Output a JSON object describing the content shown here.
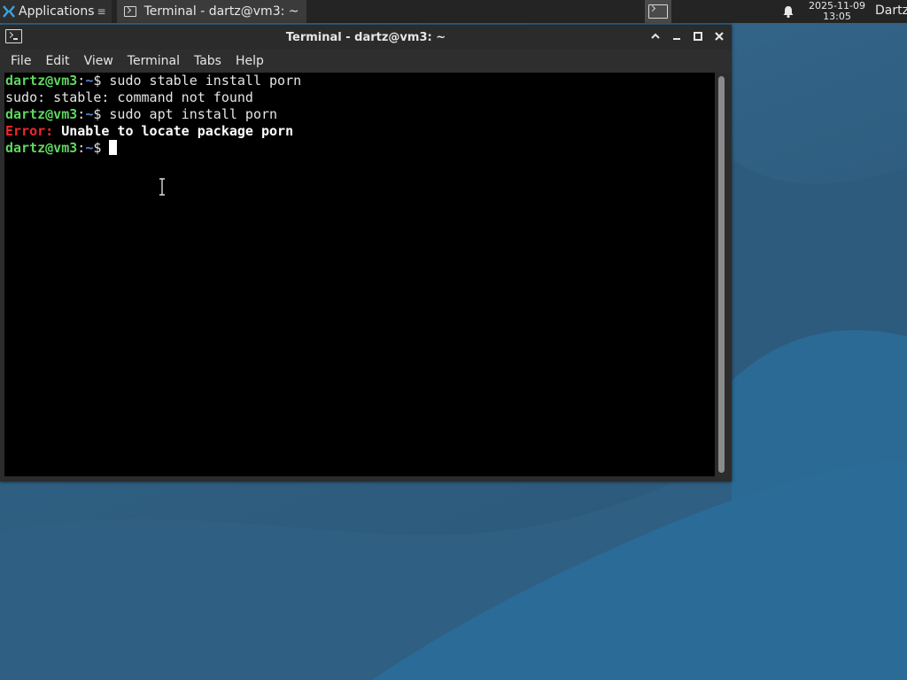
{
  "panel": {
    "applications_label": "Applications",
    "task_title": "Terminal - dartz@vm3: ~",
    "clock_date": "2025-11-09",
    "clock_time": "13:05",
    "user": "Dartz"
  },
  "window": {
    "title": "Terminal - dartz@vm3: ~",
    "menu": [
      "File",
      "Edit",
      "View",
      "Terminal",
      "Tabs",
      "Help"
    ]
  },
  "terminal": {
    "prompt_user": "dartz@vm3",
    "prompt_sep": ":",
    "prompt_path": "~",
    "prompt_symbol": "$ ",
    "lines": [
      {
        "command": "sudo stable install porn"
      },
      {
        "output": "sudo: stable: command not found"
      },
      {
        "command": "sudo apt install porn"
      },
      {
        "error_label": "Error:",
        "error_text": " Unable to locate package porn"
      },
      {
        "command": ""
      }
    ]
  },
  "colors": {
    "prompt_user": "#5fd75f",
    "prompt_path": "#5f87d7",
    "error": "#ef2929",
    "terminal_bg": "#000000"
  }
}
